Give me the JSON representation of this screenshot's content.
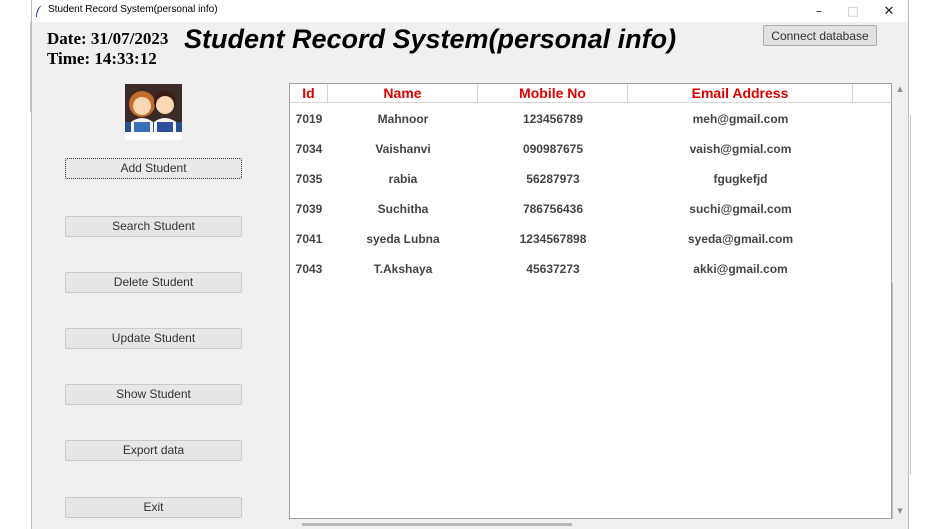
{
  "window": {
    "title": "Student Record System(personal info)",
    "controls": {
      "minimize": "–",
      "maximize": "□",
      "close": "✕"
    }
  },
  "header": {
    "date": "Date: 31/07/2023",
    "time": "Time: 14:33:12",
    "heading": "Student Record System(personal info)",
    "connect_label": "Connect database"
  },
  "sidebar": {
    "image_icon": "students-illustration",
    "buttons": [
      {
        "label": "Add Student"
      },
      {
        "label": "Search Student"
      },
      {
        "label": "Delete Student"
      },
      {
        "label": "Update Student"
      },
      {
        "label": "Show Student"
      },
      {
        "label": "Export data"
      },
      {
        "label": "Exit"
      }
    ]
  },
  "table": {
    "header_color": "#e00000",
    "columns": [
      "Id",
      "Name",
      "Mobile No",
      "Email Address"
    ],
    "rows": [
      {
        "id": "7019",
        "name": "Mahnoor",
        "mobile": "123456789",
        "email": "meh@gmail.com"
      },
      {
        "id": "7034",
        "name": "Vaishanvi",
        "mobile": "090987675",
        "email": "vaish@gmial.com"
      },
      {
        "id": "7035",
        "name": "rabia",
        "mobile": "56287973",
        "email": "fgugkefjd"
      },
      {
        "id": "7039",
        "name": "Suchitha",
        "mobile": "786756436",
        "email": "suchi@gmail.com"
      },
      {
        "id": "7041",
        "name": "syeda Lubna",
        "mobile": "1234567898",
        "email": "syeda@gmail.com"
      },
      {
        "id": "7043",
        "name": "T.Akshaya",
        "mobile": "45637273",
        "email": "akki@gmail.com"
      }
    ]
  }
}
